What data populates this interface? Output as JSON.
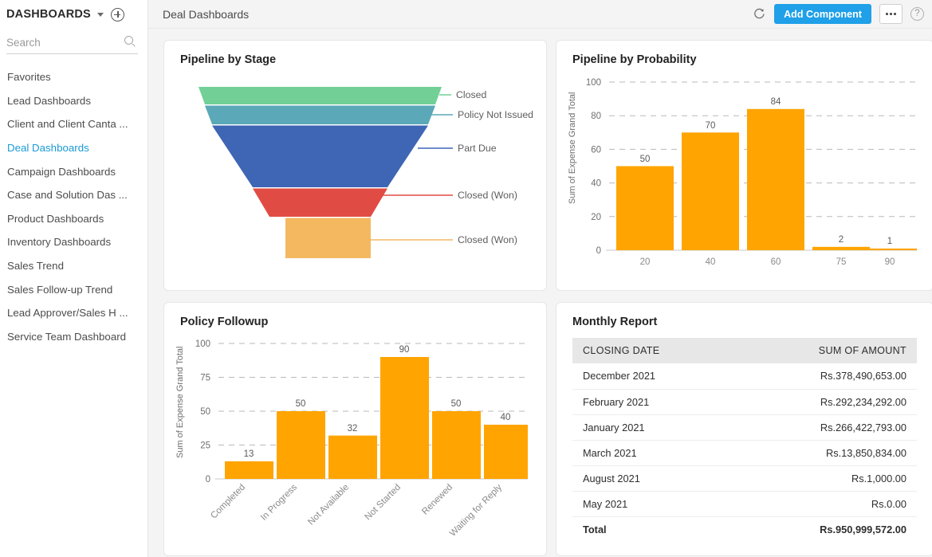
{
  "sidebar": {
    "title": "DASHBOARDS",
    "caret_icon": "chevron-down-icon",
    "add_icon": "plus-circle-icon",
    "search": {
      "value": "",
      "placeholder": "Search",
      "icon": "search-icon"
    },
    "items": [
      {
        "label": "Favorites",
        "active": false
      },
      {
        "label": "Lead Dashboards",
        "active": false
      },
      {
        "label": "Client and Client Canta ...",
        "active": false
      },
      {
        "label": "Deal Dashboards",
        "active": true
      },
      {
        "label": "Campaign Dashboards",
        "active": false
      },
      {
        "label": "Case and Solution Das ...",
        "active": false
      },
      {
        "label": "Product Dashboards",
        "active": false
      },
      {
        "label": "Inventory Dashboards",
        "active": false
      },
      {
        "label": "Sales Trend",
        "active": false
      },
      {
        "label": "Sales Follow-up Trend",
        "active": false
      },
      {
        "label": "Lead Approver/Sales H ...",
        "active": false
      },
      {
        "label": "Service Team Dashboard",
        "active": false
      }
    ]
  },
  "topbar": {
    "breadcrumb": "Deal Dashboards",
    "refresh_icon": "refresh-icon",
    "add_component_label": "Add Component",
    "more_icon": "ellipsis-icon",
    "help_icon": "help-icon",
    "help_glyph": "?",
    "accent_color": "#1fa0e8"
  },
  "cards": {
    "funnel": {
      "title": "Pipeline by Stage"
    },
    "probability": {
      "title": "Pipeline by Probability"
    },
    "followup": {
      "title": "Policy Followup"
    },
    "monthly": {
      "title": "Monthly Report"
    }
  },
  "chart_data": [
    {
      "id": "pipeline_by_stage",
      "type": "funnel",
      "title": "Pipeline by Stage",
      "legend_position": "right",
      "categories": [
        "Closed",
        "Policy Not Issued",
        "Part Due",
        "Closed (Won)",
        "Closed (Won)"
      ],
      "colors": [
        "#72d096",
        "#5aa8b8",
        "#3f65b5",
        "#e04c43",
        "#f3b860"
      ],
      "values": [
        1,
        1,
        3,
        1.4,
        1
      ]
    },
    {
      "id": "pipeline_by_probability",
      "type": "bar",
      "title": "Pipeline by Probability",
      "xlabel": "",
      "ylabel": "Sum of Expense Grand Total",
      "categories": [
        "20",
        "40",
        "60",
        "75",
        "90"
      ],
      "values": [
        50,
        70,
        84,
        2,
        1
      ],
      "ylim": [
        0,
        100
      ],
      "yticks": [
        0,
        20,
        40,
        60,
        80,
        100
      ],
      "grid": true,
      "bar_color": "#ffa400"
    },
    {
      "id": "policy_followup",
      "type": "bar",
      "title": "Policy Followup",
      "xlabel": "",
      "ylabel": "Sum of Expense Grand Total",
      "categories": [
        "Completed",
        "In Progress",
        "Not Available",
        "Not Started",
        "Renewed",
        "Waiting for Reply"
      ],
      "values": [
        13,
        50,
        32,
        90,
        50,
        40
      ],
      "ylim": [
        0,
        100
      ],
      "yticks": [
        0,
        25,
        50,
        75,
        100
      ],
      "grid": true,
      "bar_color": "#ffa400"
    },
    {
      "id": "monthly_report",
      "type": "table",
      "title": "Monthly Report",
      "columns": [
        "CLOSING DATE",
        "SUM OF AMOUNT"
      ],
      "rows": [
        [
          "December 2021",
          "Rs.378,490,653.00"
        ],
        [
          "February 2021",
          "Rs.292,234,292.00"
        ],
        [
          "January 2021",
          "Rs.266,422,793.00"
        ],
        [
          "March 2021",
          "Rs.13,850,834.00"
        ],
        [
          "August 2021",
          "Rs.1,000.00"
        ],
        [
          "May 2021",
          "Rs.0.00"
        ]
      ],
      "total_row": [
        "Total",
        "Rs.950,999,572.00"
      ]
    }
  ]
}
